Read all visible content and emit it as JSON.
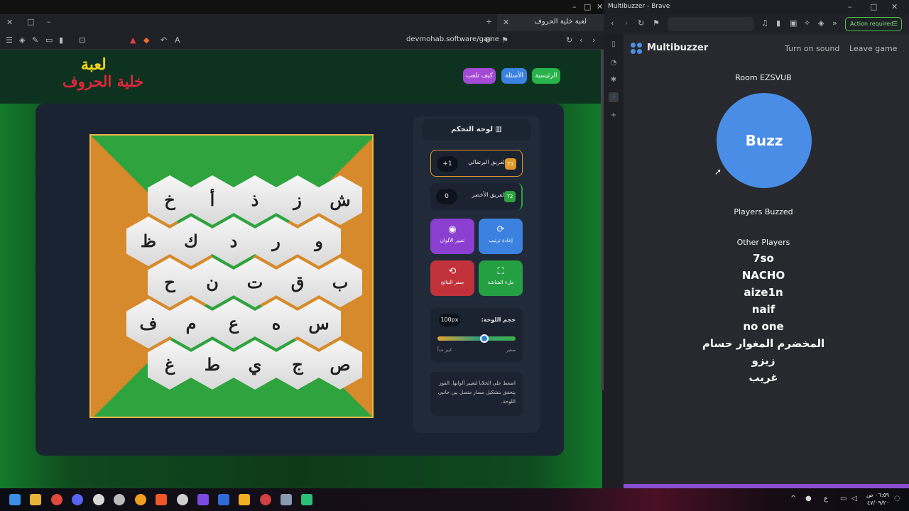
{
  "left_browser": {
    "tab_title": "لعبة خلية الحروف",
    "url": "devmohab.software/game"
  },
  "game": {
    "logo_line1": "لعبة",
    "logo_line2": "خلية الحروف",
    "nav": {
      "home": "الرئيسية",
      "questions": "الأسئلة",
      "how_to_play": "كيف تلعب"
    },
    "board_rows": [
      [
        "خ",
        "أ",
        "ذ",
        "ز",
        "ش"
      ],
      [
        "ظ",
        "ك",
        "د",
        "ر",
        "و"
      ],
      [
        "ح",
        "ن",
        "ت",
        "ق",
        "ب"
      ],
      [
        "ف",
        "م",
        "ع",
        "ه",
        "س"
      ],
      [
        "غ",
        "ط",
        "ي",
        "ج",
        "ص"
      ]
    ],
    "control_panel": {
      "title": "لوحة التحكم",
      "team_orange": {
        "name": "الفريق البرتقالي",
        "score": "+1",
        "badge": "T1"
      },
      "team_green": {
        "name": "الفريق الأخضر",
        "score": "0",
        "badge": "T2"
      },
      "buttons": {
        "reshuffle": "إعادة ترتيب",
        "change_colors": "تغيير الألوان",
        "fullscreen": "ملء الشاشة",
        "reset_results": "صفر النتائج"
      },
      "size_label": "حجم اللوحة:",
      "size_value": "100px",
      "size_min_label": "صغير",
      "size_max_label": "كبير جداً",
      "hint": "اضغط على الخلايا لتغيير ألوانها. الفوز يتحقق بتشكيل مسار متصل بين جانبي اللوحة."
    }
  },
  "right_browser": {
    "window_title": "Multibuzzer - Brave",
    "action_required": "Action required"
  },
  "multibuzzer": {
    "app_name": "Multibuzzer",
    "turn_on_sound": "Turn on sound",
    "leave_game": "Leave game",
    "room": "Room EZSVUB",
    "buzz_label": "Buzz",
    "players_buzzed_label": "Players Buzzed",
    "other_players_label": "Other Players",
    "other_players": [
      "7so",
      "NACHO",
      "aize1n",
      "naif",
      "no one",
      "المخضرم المغوار حسام",
      "زيزو",
      "غريب"
    ]
  },
  "taskbar": {
    "clock_time": "٠٦:٥٩ ص",
    "clock_date": "٤٧/٠٩/٢٠",
    "lang": "ع"
  },
  "colors": {
    "buzz_blue": "#4a8de6",
    "board_green": "#2ea33e",
    "board_orange": "#d68a2b"
  }
}
